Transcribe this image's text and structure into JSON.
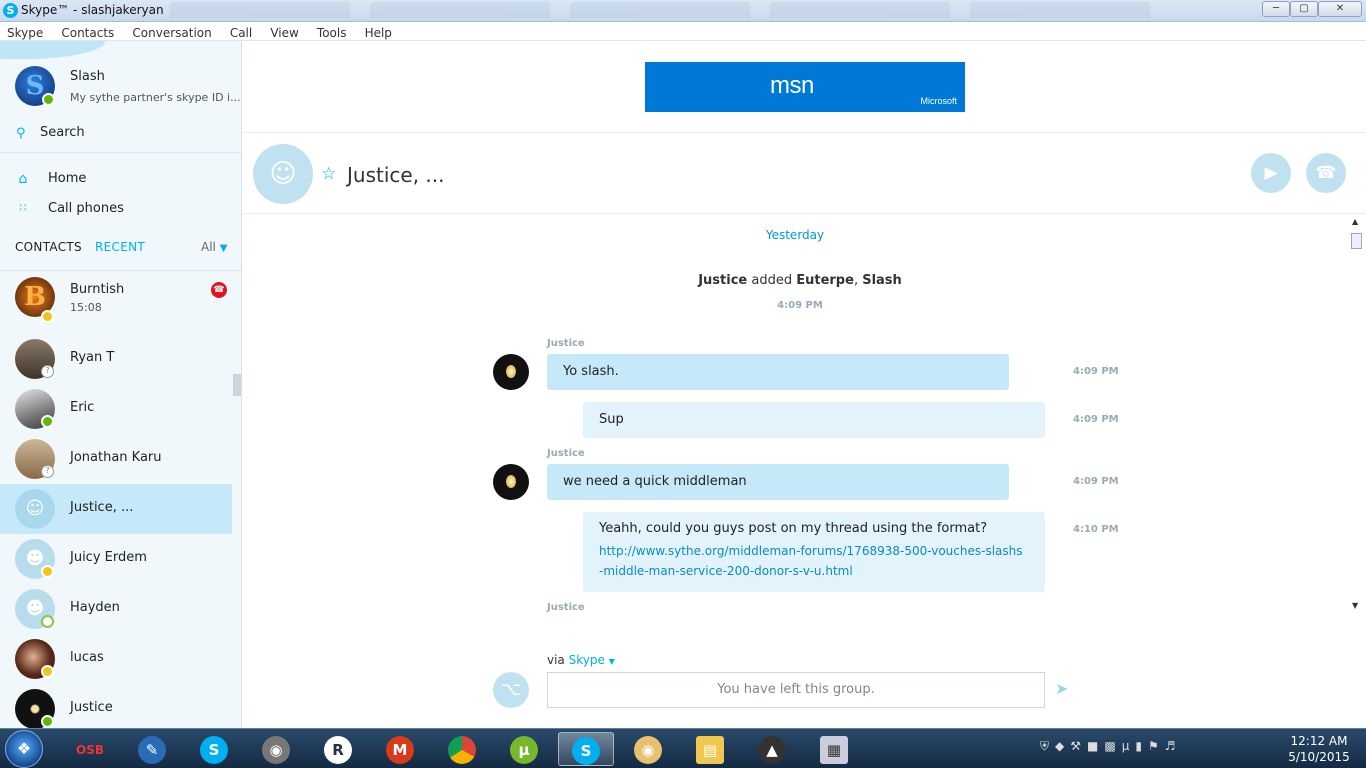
{
  "window": {
    "title": "Skype™ - slashjakeryan",
    "controls": {
      "minimize": "─",
      "maximize": "▢",
      "close": "✕"
    }
  },
  "menu": [
    "Skype",
    "Contacts",
    "Conversation",
    "Call",
    "View",
    "Tools",
    "Help"
  ],
  "profile": {
    "name": "Slash",
    "mood": "My sythe partner's skype ID i...",
    "status": "online"
  },
  "search": {
    "label": "Search"
  },
  "nav": [
    {
      "label": "Home",
      "icon": "home-icon"
    },
    {
      "label": "Call phones",
      "icon": "dialpad-icon"
    }
  ],
  "list_tabs": {
    "contacts": "CONTACTS",
    "recent": "RECENT",
    "filter": "All"
  },
  "contacts": [
    {
      "name": "Burntish",
      "time": "15:08",
      "status": "away",
      "missed_call": true,
      "avatar_text": "B"
    },
    {
      "name": "Ryan T",
      "status": "unknown"
    },
    {
      "name": "Eric",
      "status": "online"
    },
    {
      "name": "Jonathan Karu",
      "status": "unknown"
    },
    {
      "name": "Justice, ...",
      "status": "group",
      "selected": true
    },
    {
      "name": "Juicy Erdem",
      "status": "away"
    },
    {
      "name": "Hayden",
      "status": "offline"
    },
    {
      "name": "lucas",
      "status": "away"
    },
    {
      "name": "Justice",
      "status": "online"
    }
  ],
  "ad": {
    "brand": "msn",
    "sponsor": "Microsoft"
  },
  "conversation": {
    "title": "Justice, ...",
    "day_label": "Yesterday",
    "system_event": {
      "actor": "Justice",
      "action": "added",
      "targets": [
        "Euterpe",
        "Slash"
      ],
      "time": "4:09 PM"
    },
    "messages": [
      {
        "sender": "Justice",
        "text": "Yo slash.",
        "time": "4:09 PM",
        "direction": "in"
      },
      {
        "sender": "",
        "text": "Sup",
        "time": "4:09 PM",
        "direction": "out"
      },
      {
        "sender": "Justice",
        "text": "we need a quick middleman",
        "time": "4:09 PM",
        "direction": "in"
      },
      {
        "sender": "",
        "text": "Yeahh, could you guys post on my thread using the format?",
        "link_line1": "http://www.sythe.org/middleman-forums/1768938-500-vouches-slashs",
        "link_line2": "-middle-man-service-200-donor-s-v-u.html",
        "time": "4:10 PM",
        "direction": "out"
      }
    ],
    "trailing_sender": "Justice"
  },
  "compose": {
    "via_label": "via",
    "via_service": "Skype",
    "placeholder": "You have left this group."
  },
  "taskbar": {
    "apps": [
      "OSB",
      "Notepad",
      "Skype",
      "RS",
      "Runescape",
      "Media",
      "Chrome",
      "uTorrent",
      "Skype",
      "Paint",
      "Explorer",
      "Mystery",
      "Calculator"
    ],
    "clock_time": "12:12 AM",
    "clock_date": "5/10/2015"
  },
  "colors": {
    "accent": "#00aff0",
    "selected_bg": "#c6e9f9",
    "incoming_bubble": "#c6e9f9",
    "outgoing_bubble": "#e3f3fb",
    "online": "#5fb800",
    "away": "#f6c31b",
    "missed_call": "#e3141e",
    "msn_blue": "#0078d7"
  }
}
